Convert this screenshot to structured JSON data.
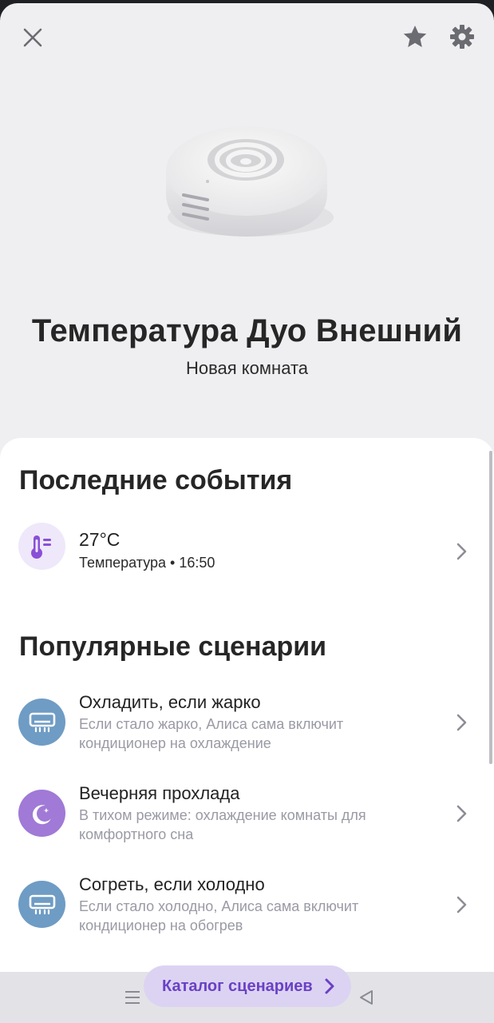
{
  "device": {
    "name": "Температура Дуо Внешний",
    "room": "Новая комната"
  },
  "events": {
    "title": "Последние события",
    "items": [
      {
        "value": "27°C",
        "detail": "Температура • 16:50",
        "icon": "thermometer-icon"
      }
    ]
  },
  "scenarios": {
    "title": "Популярные сценарии",
    "items": [
      {
        "title": "Охладить, если жарко",
        "description": "Если стало жарко, Алиса сама включит кондиционер на охлаждение",
        "icon": "air-conditioner-icon",
        "color": "#6f9cc4"
      },
      {
        "title": "Вечерняя прохлада",
        "description": "В тихом режиме: охлаждение комнаты для комфортного сна",
        "icon": "moon-icon",
        "color": "#a07ad6"
      },
      {
        "title": "Согреть, если холодно",
        "description": "Если стало холодно, Алиса сама включит кондиционер на обогрев",
        "icon": "air-conditioner-icon",
        "color": "#6f9cc4"
      }
    ]
  },
  "catalog_button": {
    "label": "Каталог сценариев"
  },
  "colors": {
    "accent": "#6a41c4",
    "accent_bg": "#dcd3f3",
    "thermo": "#8a4fd6"
  }
}
